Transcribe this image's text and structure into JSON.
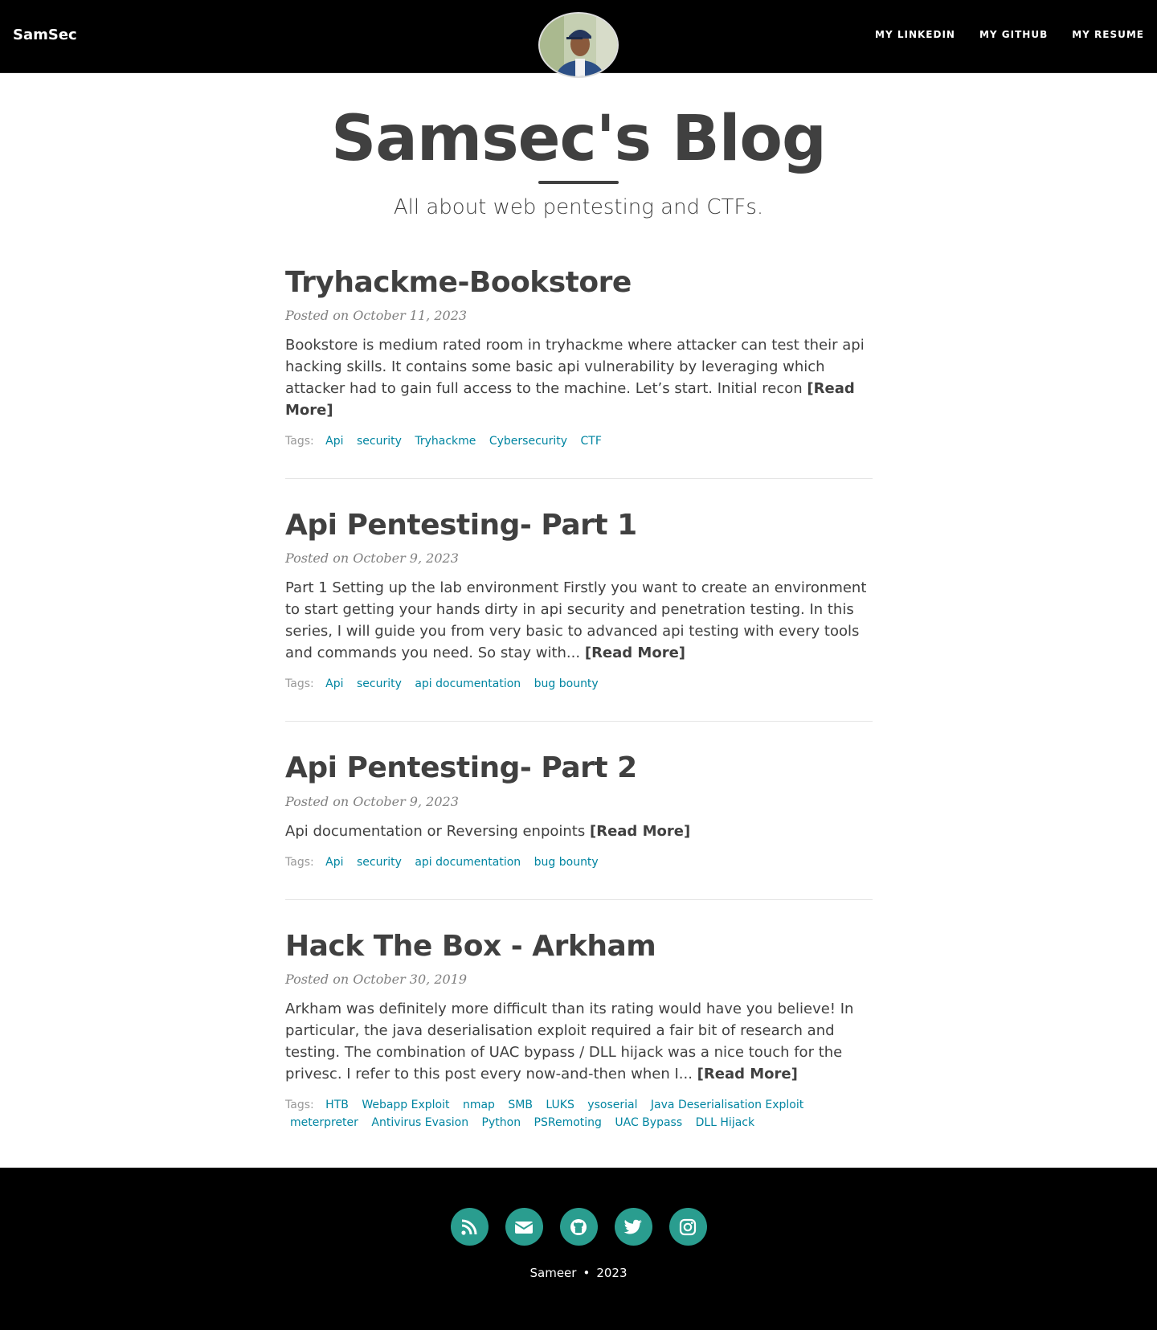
{
  "navbar": {
    "brand": "SamSec",
    "links": [
      "MY LINKEDIN",
      "MY GITHUB",
      "MY RESUME"
    ]
  },
  "header": {
    "title": "Samsec's Blog",
    "subtitle": "All about web pentesting and CTFs."
  },
  "posts": [
    {
      "title": "Tryhackme-Bookstore",
      "meta": "Posted on October 11, 2023",
      "excerpt": "Bookstore is medium rated room in tryhackme where attacker can test their api hacking skills. It contains some basic api vulnerability by leveraging which attacker had to gain full access to the machine. Let’s start. Initial recon",
      "read_more": "[Read More]",
      "tags_label": "Tags:",
      "tags": [
        "Api",
        "security",
        "Tryhackme",
        "Cybersecurity",
        "CTF"
      ]
    },
    {
      "title": "Api Pentesting- Part 1",
      "meta": "Posted on October 9, 2023",
      "excerpt": "Part 1 Setting up the lab environment Firstly you want to create an environment to start getting your hands dirty in api security and penetration testing. In this series, I will guide you from very basic to advanced api testing with every tools and commands you need. So stay with...",
      "read_more": "[Read More]",
      "tags_label": "Tags:",
      "tags": [
        "Api",
        "security",
        "api documentation",
        "bug bounty"
      ]
    },
    {
      "title": "Api Pentesting- Part 2",
      "meta": "Posted on October 9, 2023",
      "excerpt": "Api documentation or Reversing enpoints",
      "read_more": "[Read More]",
      "tags_label": "Tags:",
      "tags": [
        "Api",
        "security",
        "api documentation",
        "bug bounty"
      ]
    },
    {
      "title": "Hack The Box - Arkham",
      "meta": "Posted on October 30, 2019",
      "excerpt": "Arkham was definitely more difficult than its rating would have you believe! In particular, the java deserialisation exploit required a fair bit of research and testing. The combination of UAC bypass / DLL hijack was a nice touch for the privesc. I refer to this post every now-and-then when I...",
      "read_more": "[Read More]",
      "tags_label": "Tags:",
      "tags": [
        "HTB",
        "Webapp Exploit",
        "nmap",
        "SMB",
        "LUKS",
        "ysoserial",
        "Java Deserialisation Exploit",
        "meterpreter",
        "Antivirus Evasion",
        "Python",
        "PSRemoting",
        "UAC Bypass",
        "DLL Hijack"
      ]
    }
  ],
  "footer": {
    "social_icons": [
      "rss-icon",
      "email-icon",
      "github-icon",
      "twitter-icon",
      "instagram-icon"
    ],
    "author": "Sameer",
    "separator": "•",
    "year": "2023"
  },
  "colors": {
    "navbar_bg": "#000000",
    "text": "#404040",
    "tag_link": "#0085a1",
    "social_bg": "#2a9d8f"
  }
}
